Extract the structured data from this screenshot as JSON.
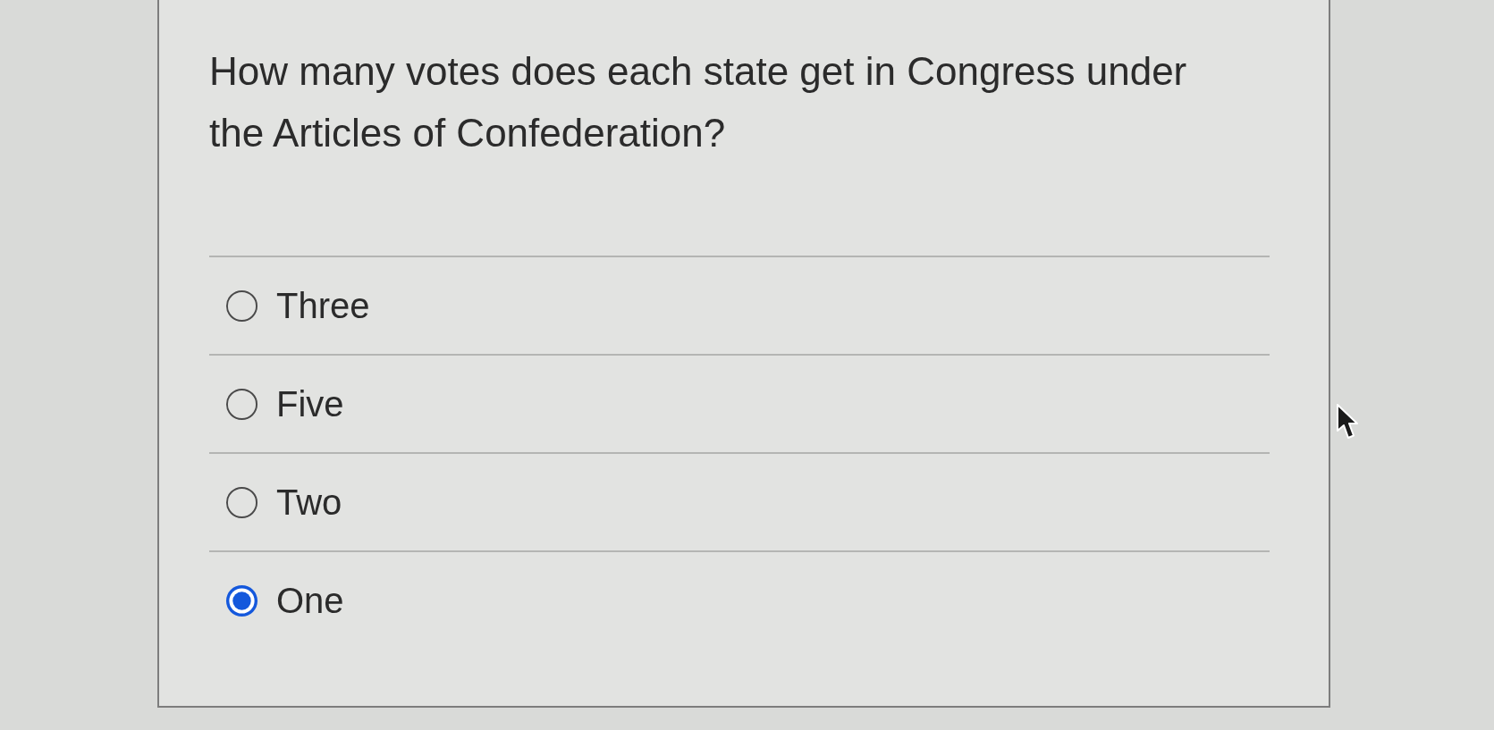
{
  "question": {
    "text": "How many votes does each state get in Congress under the Articles of Confederation?"
  },
  "options": [
    {
      "label": "Three",
      "selected": false
    },
    {
      "label": "Five",
      "selected": false
    },
    {
      "label": "Two",
      "selected": false
    },
    {
      "label": "One",
      "selected": true
    }
  ]
}
